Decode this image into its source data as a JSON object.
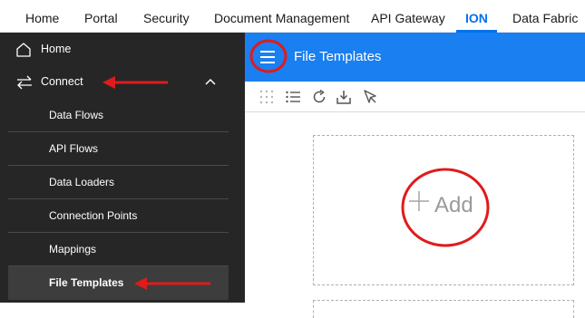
{
  "top_nav": {
    "tabs": [
      {
        "label": "Home"
      },
      {
        "label": "Portal"
      },
      {
        "label": "Security"
      },
      {
        "label": "Document Management"
      },
      {
        "label": "API Gateway"
      },
      {
        "label": "ION",
        "active": true
      },
      {
        "label": "Data Fabric"
      }
    ]
  },
  "sidebar": {
    "home": {
      "label": "Home",
      "icon": "home-icon"
    },
    "connect": {
      "label": "Connect",
      "icon": "swap-arrows-icon",
      "expanded": true,
      "toggle_icon": "chevron-up-icon"
    },
    "connect_items": [
      {
        "label": "Data Flows"
      },
      {
        "label": "API Flows"
      },
      {
        "label": "Data Loaders"
      },
      {
        "label": "Connection Points"
      },
      {
        "label": "Mappings"
      },
      {
        "label": "File Templates",
        "selected": true
      }
    ]
  },
  "header": {
    "title": "File Templates",
    "menu_icon": "hamburger-menu-icon"
  },
  "toolbar": {
    "icons": [
      "grid-view-icon",
      "list-view-icon",
      "refresh-icon",
      "import-icon",
      "select-pointer-icon"
    ]
  },
  "content": {
    "add_label": "Add",
    "add_icon": "plus-icon"
  },
  "colors": {
    "accent": "#0072ed",
    "header_bg": "#1a7ff0",
    "sidebar_bg": "#262626",
    "annotation_red": "#e01b1b"
  }
}
